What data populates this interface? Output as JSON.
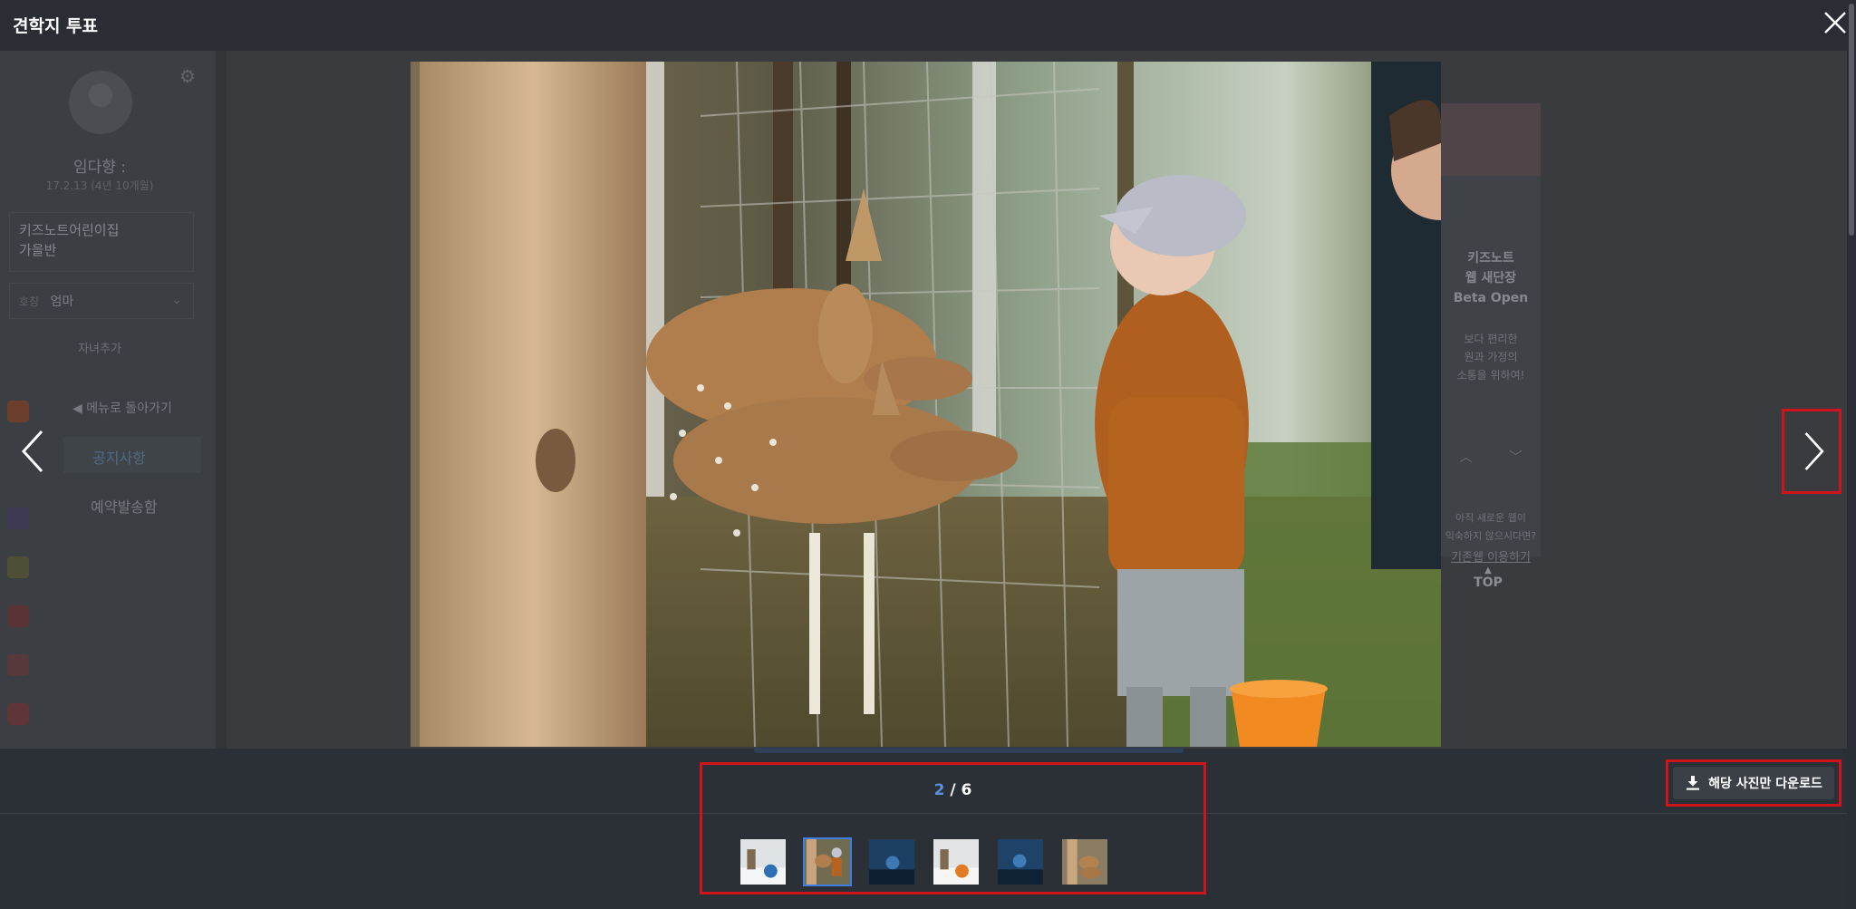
{
  "viewer": {
    "title": "견학지 투표",
    "counter": {
      "current": "2",
      "separator": " / ",
      "total": "6"
    },
    "download_label": "해당 사진만 다운로드",
    "thumbnails": [
      {
        "icon": "thumbnail-snow-scene",
        "active": false
      },
      {
        "icon": "thumbnail-deer-feeding",
        "active": true
      },
      {
        "icon": "thumbnail-blue-night",
        "active": false
      },
      {
        "icon": "thumbnail-snow-scene",
        "active": false
      },
      {
        "icon": "thumbnail-blue-night",
        "active": false
      },
      {
        "icon": "thumbnail-deer-pair",
        "active": false
      }
    ]
  },
  "background": {
    "profile": {
      "name": "임다향 :",
      "date": "17.2.13 (4년 10개월)"
    },
    "class_box": {
      "line1": "키즈노트어린이집",
      "line2": "가을반"
    },
    "relation": {
      "label": "호칭",
      "value": "엄마"
    },
    "add_child": "자녀추가",
    "back_to_menu": "메뉴로 돌아가기",
    "menu": {
      "notice": "공지사항",
      "reservation": "예약발송함"
    },
    "ad": {
      "title_lines": [
        "키즈노트",
        "웹 새단장",
        "Beta Open"
      ],
      "sub_lines": [
        "보다 편리한",
        "원과 가정의",
        "소통을 위하여!"
      ],
      "note_lines": [
        "아직 새로운 웹이",
        "익숙하지 않으시다면?"
      ],
      "link": "기존웹 이용하기"
    },
    "top_button": "TOP"
  },
  "colors": {
    "accent": "#3f7de0",
    "highlight_outline": "#d0141b",
    "counter_current": "#5c8fe0"
  }
}
